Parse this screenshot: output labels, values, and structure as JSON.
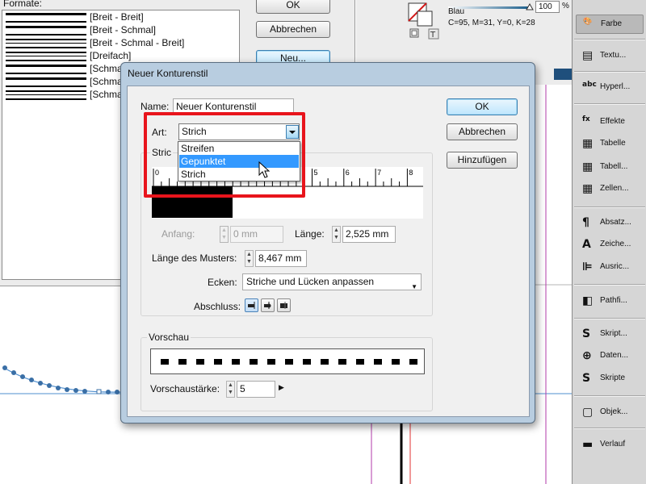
{
  "background_dialog": {
    "formats_label": "Formate:",
    "formats": [
      {
        "name": "[Breit - Breit]",
        "lines": 2
      },
      {
        "name": "[Breit - Schmal]",
        "lines": 2
      },
      {
        "name": "[Breit - Schmal - Breit]",
        "lines": 3
      },
      {
        "name": "[Dreifach]",
        "lines": 3
      },
      {
        "name": "[Schma",
        "lines": 2
      },
      {
        "name": "[Schma",
        "lines": 2
      },
      {
        "name": "[Schma",
        "lines": 3
      }
    ],
    "ok_label": "OK",
    "cancel_label": "Abbrechen",
    "new_label": "Neu..."
  },
  "swatch_panel": {
    "tint_value": "100",
    "tint_unit": "%",
    "color_name": "Blau",
    "color_values": "C=95, M=31, Y=0, K=28",
    "colors": {
      "blue": "#1f4f7c"
    }
  },
  "dock": {
    "items": [
      {
        "label": "Farbe",
        "icon": "color-palette-icon",
        "active": true
      },
      {
        "label": "Textu...",
        "icon": "text-wrap-icon"
      },
      {
        "label": "Hyperl...",
        "icon": "hyperlinks-icon"
      },
      {
        "label": "Effekte",
        "icon": "fx-effects-icon"
      },
      {
        "label": "Tabelle",
        "icon": "table-icon"
      },
      {
        "label": "Tabell...",
        "icon": "table-styles-icon"
      },
      {
        "label": "Zellen...",
        "icon": "cell-styles-icon"
      },
      {
        "label": "Absatz...",
        "icon": "paragraph-styles-icon"
      },
      {
        "label": "Zeiche...",
        "icon": "character-styles-icon"
      },
      {
        "label": "Ausric...",
        "icon": "align-icon"
      },
      {
        "label": "Pathfi...",
        "icon": "pathfinder-icon"
      },
      {
        "label": "Skript...",
        "icon": "script-label-icon"
      },
      {
        "label": "Daten...",
        "icon": "data-merge-icon"
      },
      {
        "label": "Skripte",
        "icon": "scripts-icon"
      },
      {
        "label": "Objek...",
        "icon": "object-styles-icon"
      },
      {
        "label": "Verlauf",
        "icon": "gradient-icon"
      }
    ]
  },
  "dialog": {
    "title": "Neuer Konturenstil",
    "name_label": "Name:",
    "name_value": "Neuer Konturenstil",
    "art_label": "Art:",
    "art_value": "Strich",
    "art_options": [
      "Streifen",
      "Gepunktet",
      "Strich"
    ],
    "art_selected": "Gepunktet",
    "group_label": "Stric",
    "ruler_ticks": [
      "0",
      "1",
      "2",
      "3",
      "4",
      "5",
      "6",
      "7",
      "8"
    ],
    "anfang_label": "Anfang:",
    "anfang_value": "0 mm",
    "laenge_label": "Länge:",
    "laenge_value": "2,525 mm",
    "muster_label": "Länge des Musters:",
    "muster_value": "8,467 mm",
    "ecken_label": "Ecken:",
    "ecken_value": "Striche und Lücken anpassen",
    "abschluss_label": "Abschluss:",
    "preview_label": "Vorschau",
    "preview_weight_label": "Vorschaustärke:",
    "preview_weight_value": "5",
    "ok_label": "OK",
    "cancel_label": "Abbrechen",
    "add_label": "Hinzufügen"
  },
  "colors": {
    "highlight": "#e8141c",
    "selection": "#3399ff",
    "dialog_frame": "#b8cde0"
  }
}
